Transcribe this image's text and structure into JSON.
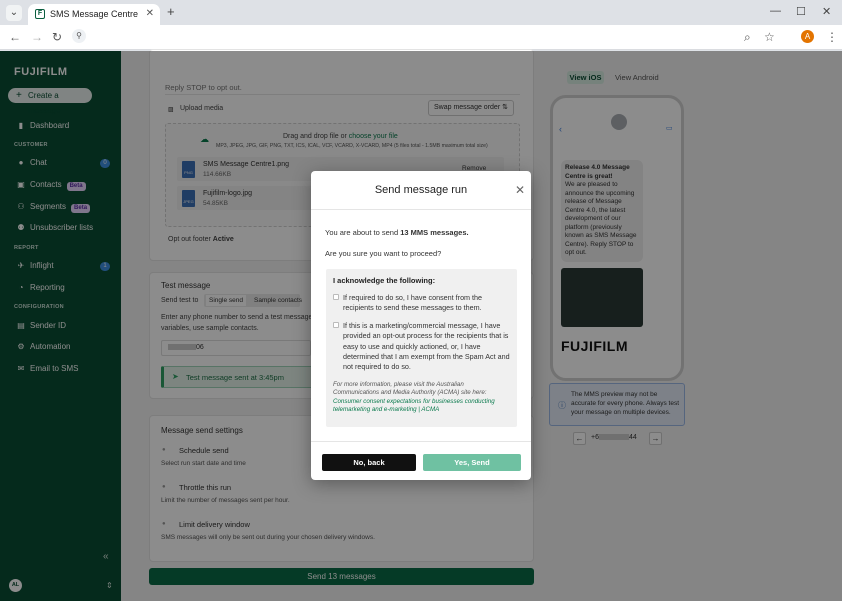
{
  "browser": {
    "tab_title": "SMS Message Centre",
    "tab_favicon": "F",
    "avatar_letter": "A"
  },
  "sidebar": {
    "logo": "FUJIFILM",
    "create_label": "Create a message",
    "dashboard": "Dashboard",
    "section_customer": "CUSTOMER",
    "chat": "Chat",
    "chat_count": "0",
    "contacts": "Contacts",
    "segments": "Segments",
    "beta": "Beta",
    "unsubscriber_lists": "Unsubscriber lists",
    "section_report": "REPORT",
    "inflight": "Inflight",
    "inflight_count": "1",
    "reporting": "Reporting",
    "section_configuration": "CONFIGURATION",
    "sender_id": "Sender ID",
    "automation": "Automation",
    "email_to_sms": "Email to SMS",
    "user_initials": "AL"
  },
  "compose": {
    "reply_stop": "Reply STOP to opt out.",
    "upload_media": "Upload media",
    "swap_order": "Swap message order",
    "drag_drop": "Drag and drop file or",
    "choose_file": "choose your file",
    "formats": "MP3, JPEG, JPG, GIF, PNG, TXT, ICS, ICAL, VCF, VCARD, X-VCARD, MP4 (5 files total - 1.5MB maximum total size)",
    "file1_name": "SMS Message Centre1.png",
    "file1_size": "114.66KB",
    "file1_type": "PNG",
    "remove": "Remove",
    "file2_name": "Fujifilm-logo.jpg",
    "file2_size": "54.85KB",
    "file2_type": "JPEG",
    "optout_label": "Opt out footer",
    "optout_value": "Active"
  },
  "test_message": {
    "title": "Test message",
    "send_test_to": "Send test to",
    "single_send": "Single send",
    "sample_contacts": "Sample contacts",
    "hint_line1": "Enter any phone number to send a test message",
    "hint_line2": "variables, use sample contacts.",
    "phone_suffix": "06",
    "sent_status": "Test message sent at 3:45pm"
  },
  "send_settings": {
    "title": "Message send settings",
    "schedule": "Schedule send",
    "schedule_desc": "Select run start date and time",
    "throttle": "Throttle this run",
    "throttle_desc": "Limit the number of messages sent per hour.",
    "limit": "Limit delivery window",
    "limit_desc": "SMS messages will only be sent out during your chosen delivery windows."
  },
  "send_button": "Send 13 messages",
  "preview": {
    "view_ios": "View iOS",
    "view_android": "View Android",
    "bubble_title": "Release 4.0 Message Centre is great!",
    "bubble_body": "We are pleased to announce the upcoming release of Message Centre 4.0, the latest development of our platform (previously known as SMS Message Centre). Reply STOP to opt out.",
    "logo_text": "FUJIFILM",
    "notice": "The MMS preview may not be accurate for every phone. Always test your message on multiple devices.",
    "number_prefix": "+6",
    "number_suffix": "44"
  },
  "modal": {
    "title": "Send message run",
    "intro": "You are about to send",
    "count": "13 MMS messages.",
    "question": "Are you sure you want to proceed?",
    "ack_title": "I acknowledge the following:",
    "ack1": "If required to do so, I have consent from the recipients to send these messages to them.",
    "ack2": "If this is a marketing/commercial message, I have provided an opt-out process for the recipients that is easy to use and quickly actioned, or, I have determined that I am exempt from the Spam Act and not required to do so.",
    "info": "For more information, please visit the Australian Communications and Media Authority (ACMA) site here:",
    "info_link": "Consumer consent expectations for businesses conducting telemarketing and e-marketing | ACMA",
    "no_label": "No, back",
    "yes_label": "Yes, Send"
  }
}
